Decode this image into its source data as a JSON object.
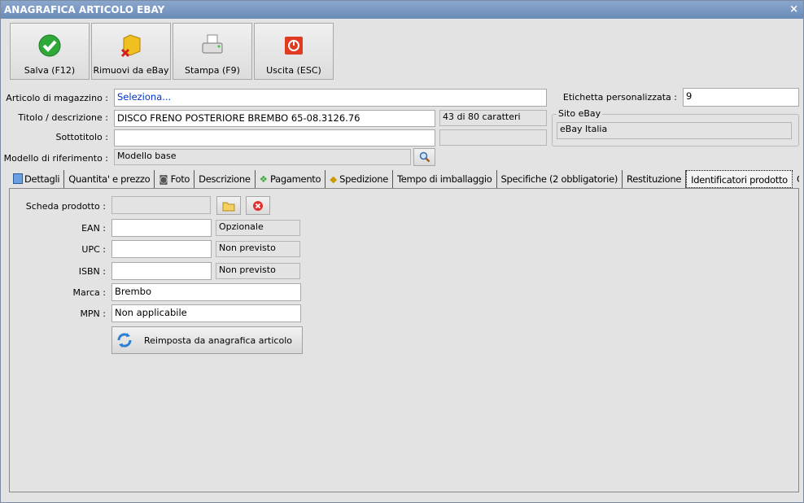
{
  "window": {
    "title": "ANAGRAFICA ARTICOLO EBAY",
    "close": "×"
  },
  "toolbar": {
    "save": "Salva (F12)",
    "remove": "Rimuovi da eBay",
    "print": "Stampa (F9)",
    "exit": "Uscita (ESC)"
  },
  "form": {
    "articolo_label": "Articolo di magazzino :",
    "articolo_value": "Seleziona...",
    "titolo_label": "Titolo / descrizione :",
    "titolo_value": "DISCO FRENO POSTERIORE BREMBO 65-08.3126.76",
    "titolo_counter": "43 di 80 caratteri",
    "sottotitolo_label": "Sottotitolo :",
    "sottotitolo_value": "",
    "modello_label": "Modello di riferimento :",
    "modello_value": "Modello base",
    "etichetta_label": "Etichetta personalizzata :",
    "etichetta_value": "9",
    "sito_label": "Sito eBay",
    "sito_value": "eBay Italia"
  },
  "tabs": [
    "Dettagli",
    "Quantita' e prezzo",
    "Foto",
    "Descrizione",
    "Pagamento",
    "Spedizione",
    "Tempo di imballaggio",
    "Specifiche (2 obbligatorie)",
    "Restituzione",
    "Identificatori prodotto",
    "Compatib"
  ],
  "identifiers": {
    "scheda_label": "Scheda prodotto :",
    "scheda_value": "",
    "ean_label": "EAN :",
    "ean_value": "",
    "ean_status": "Opzionale",
    "upc_label": "UPC :",
    "upc_value": "",
    "upc_status": "Non previsto",
    "isbn_label": "ISBN :",
    "isbn_value": "",
    "isbn_status": "Non previsto",
    "marca_label": "Marca :",
    "marca_value": "Brembo",
    "mpn_label": "MPN :",
    "mpn_value": "Non applicabile",
    "reset_label": "Reimposta da anagrafica articolo"
  }
}
